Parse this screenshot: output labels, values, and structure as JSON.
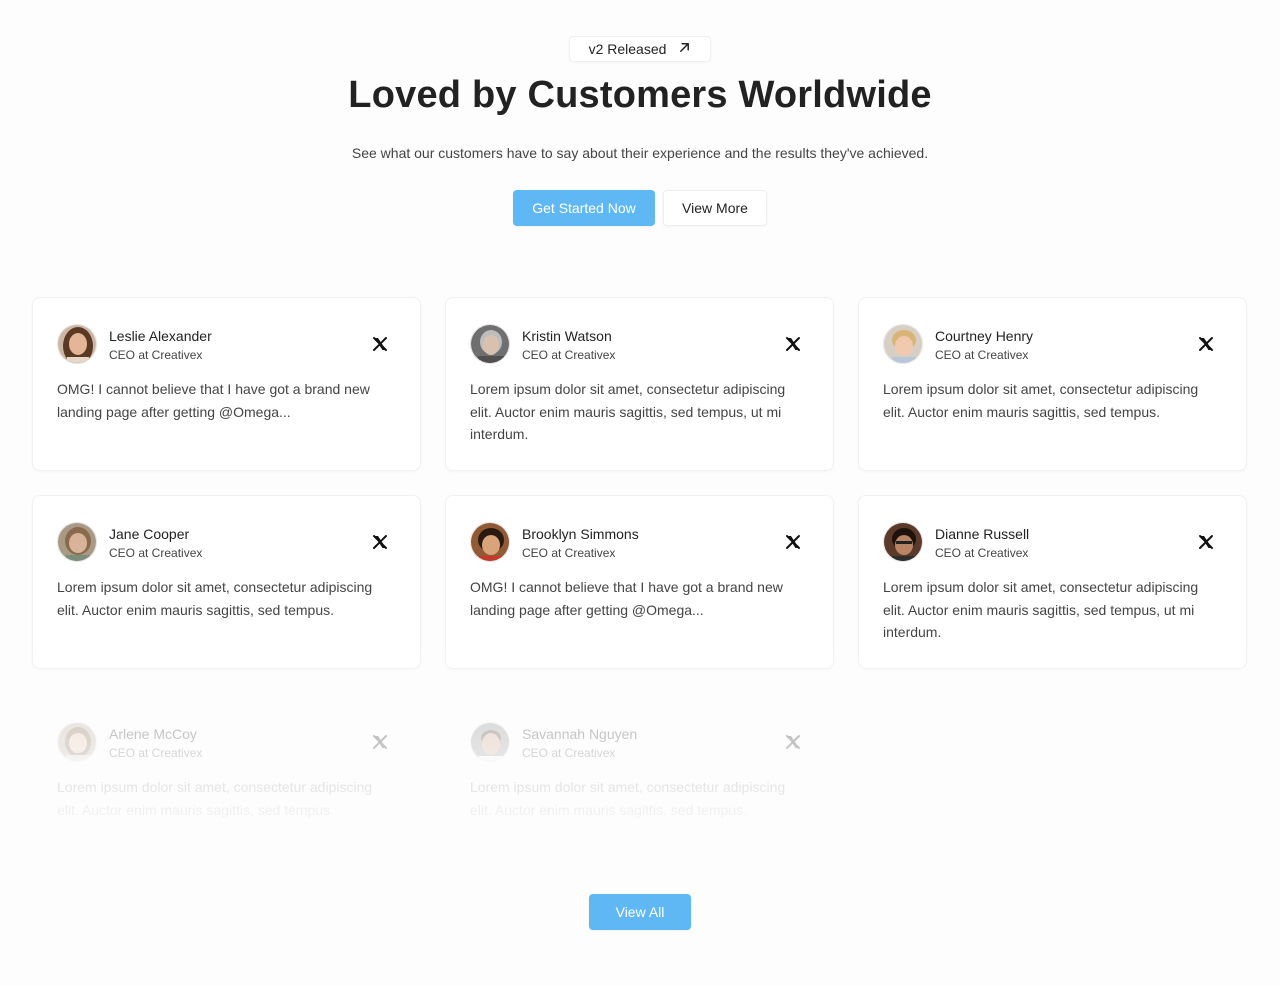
{
  "hero": {
    "badge_label": "v2 Released",
    "title": "Loved by Customers Worldwide",
    "subtitle": "See what our customers have to say about their experience and the results they've achieved.",
    "primary_button": "Get Started Now",
    "secondary_button": "View More"
  },
  "testimonials": [
    {
      "name": "Leslie Alexander",
      "role": "CEO at Creativex",
      "quote": "OMG! I cannot believe that I have got a brand new landing page after getting @Omega..."
    },
    {
      "name": "Kristin Watson",
      "role": "CEO at Creativex",
      "quote": "Lorem ipsum dolor sit amet, consectetur adipiscing elit. Auctor enim mauris sagittis, sed tempus, ut mi interdum."
    },
    {
      "name": "Courtney Henry",
      "role": "CEO at Creativex",
      "quote": "Lorem ipsum dolor sit amet, consectetur adipiscing elit. Auctor enim mauris sagittis, sed tempus."
    },
    {
      "name": "Jane Cooper",
      "role": "CEO at Creativex",
      "quote": "Lorem ipsum dolor sit amet, consectetur adipiscing elit. Auctor enim mauris sagittis, sed tempus."
    },
    {
      "name": "Brooklyn Simmons",
      "role": "CEO at Creativex",
      "quote": "OMG! I cannot believe that I have got a brand new landing page after getting @Omega..."
    },
    {
      "name": "Dianne Russell",
      "role": "CEO at Creativex",
      "quote": "Lorem ipsum dolor sit amet, consectetur adipiscing elit. Auctor enim mauris sagittis, sed tempus, ut mi interdum."
    },
    {
      "name": "Arlene McCoy",
      "role": "CEO at Creativex",
      "quote": "Lorem ipsum dolor sit amet, consectetur adipiscing elit. Auctor enim mauris sagittis, sed tempus."
    },
    {
      "name": "Savannah Nguyen",
      "role": "CEO at Creativex",
      "quote": "Lorem ipsum dolor sit amet, consectetur adipiscing elit. Auctor enim mauris sagittis, sed tempus."
    }
  ],
  "footer": {
    "view_all_button": "View All"
  },
  "icons": {
    "badge": "arrow-up-right-icon",
    "social": "x-logo-icon"
  },
  "colors": {
    "accent": "#5fb8f4",
    "text": "#222222",
    "muted": "#444444"
  }
}
